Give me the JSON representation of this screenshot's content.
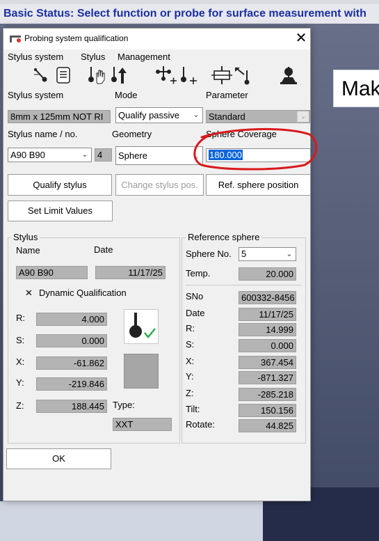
{
  "status_bar": {
    "text": "Basic Status: Select function or probe for surface measurement with"
  },
  "background_card": {
    "text": "Mak"
  },
  "dialog": {
    "title": "Probing system qualification",
    "menu": [
      "Stylus system",
      "Stylus",
      "Management"
    ],
    "toolbar_icons": [
      "stylus-config-icon",
      "stylus-database-icon",
      "stylus-hand-icon",
      "stylus-up-icon",
      "add-star-stylus-icon",
      "add-stylus-icon",
      "probe-head-icon",
      "probe-change-icon",
      "reference-sphere-icon"
    ],
    "labels": {
      "stylus_system": "Stylus system",
      "mode": "Mode",
      "parameter": "Parameter",
      "stylus_name": "Stylus name / no.",
      "geometry": "Geometry",
      "sphere_coverage": "Sphere Coverage"
    },
    "stylus_system_value": "8mm x 125mm NOT RI",
    "mode_value": "Qualify passive",
    "parameter_value": "Standard",
    "stylus_name_value": "A90 B90",
    "stylus_number": "4",
    "geometry_value": "Sphere",
    "sphere_coverage_value": "180.000",
    "buttons": {
      "qualify_stylus": "Qualify stylus",
      "change_stylus_pos": "Change stylus pos.",
      "ref_sphere_position": "Ref. sphere position",
      "set_limit_values": "Set Limit Values",
      "ok": "OK"
    },
    "stylus_group": {
      "title": "Stylus",
      "name_label": "Name",
      "date_label": "Date",
      "name_value": "A90 B90",
      "date_value": "11/17/25",
      "dynamic_mark": "✕",
      "dynamic_label": "Dynamic Qualification",
      "rows": [
        {
          "label": "R:",
          "value": "4.000"
        },
        {
          "label": "S:",
          "value": "0.000"
        },
        {
          "label": "X:",
          "value": "-61.862"
        },
        {
          "label": "Y:",
          "value": "-219.846"
        },
        {
          "label": "Z:",
          "value": "188.445"
        }
      ],
      "type_label": "Type:",
      "type_value": "XXT"
    },
    "sphere_group": {
      "title": "Reference sphere",
      "sphere_no_label": "Sphere No.",
      "sphere_no_value": "5",
      "temp_label": "Temp.",
      "temp_value": "20.000",
      "rows": [
        {
          "label": "SNo",
          "value": "600332-8456"
        },
        {
          "label": "Date",
          "value": "11/17/25"
        },
        {
          "label": "R:",
          "value": "14.999"
        },
        {
          "label": "S:",
          "value": "0.000"
        },
        {
          "label": "X:",
          "value": "367.454"
        },
        {
          "label": "Y:",
          "value": "-871.327"
        },
        {
          "label": "Z:",
          "value": "-285.218"
        },
        {
          "label": "Tilt:",
          "value": "150.156"
        },
        {
          "label": "Rotate:",
          "value": "44.825"
        }
      ]
    },
    "annotation": {
      "color": "#d9191c"
    }
  }
}
